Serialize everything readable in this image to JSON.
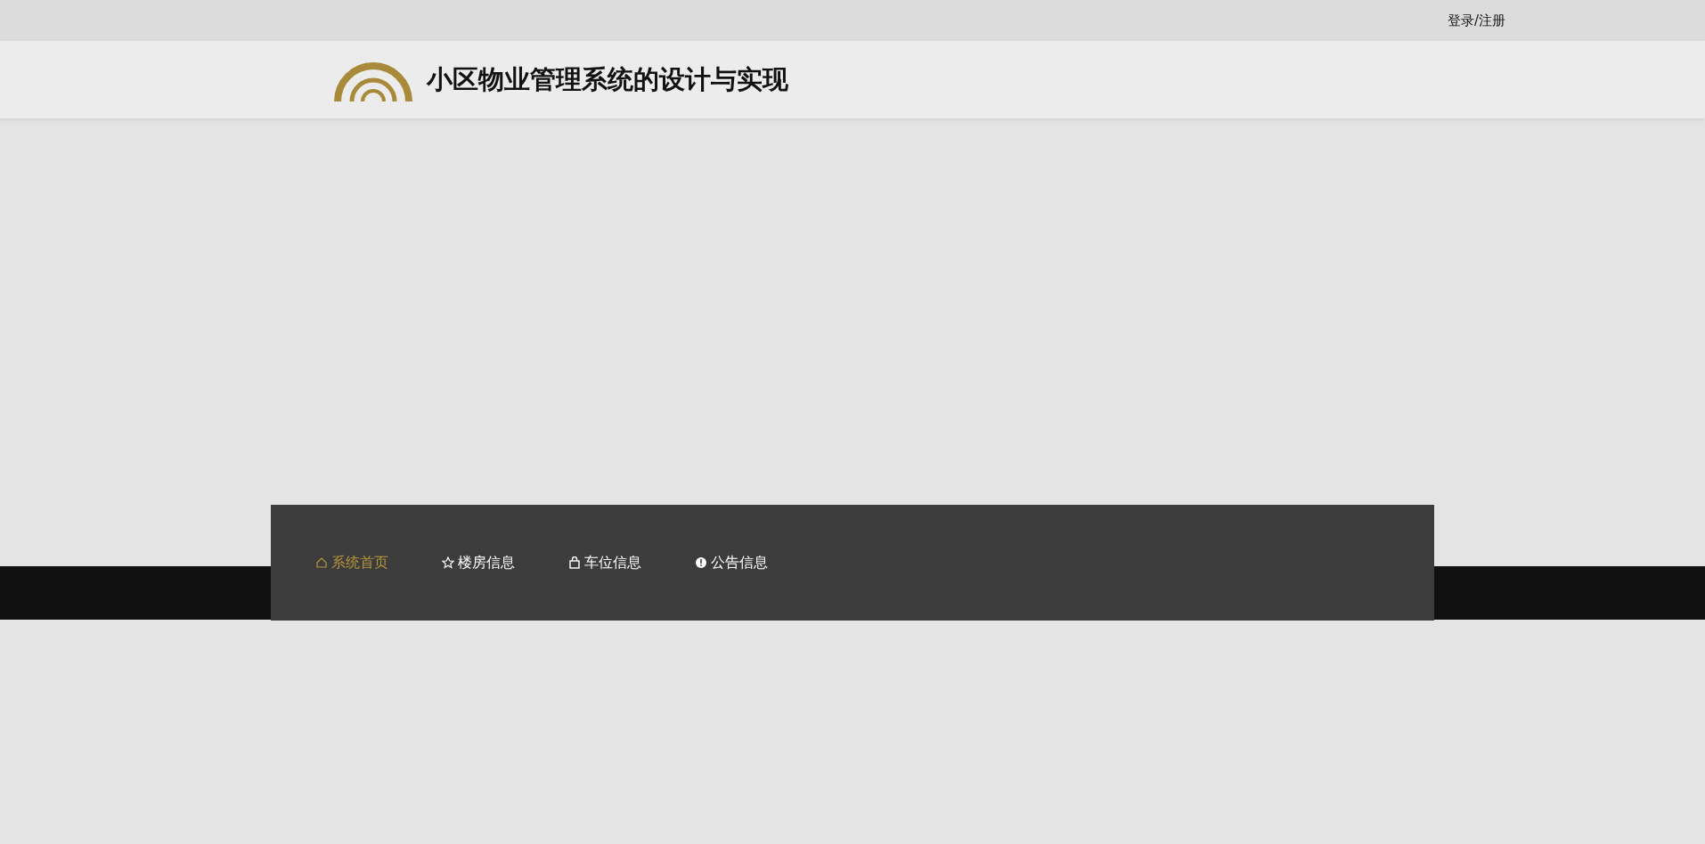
{
  "top_bar": {
    "login_link": "登录/注册"
  },
  "header": {
    "title": "小区物业管理系统的设计与实现"
  },
  "nav": {
    "items": [
      {
        "label": "系统首页",
        "selected": true
      },
      {
        "label": "楼房信息",
        "selected": false
      },
      {
        "label": "车位信息",
        "selected": false
      },
      {
        "label": "公告信息",
        "selected": false
      }
    ]
  }
}
